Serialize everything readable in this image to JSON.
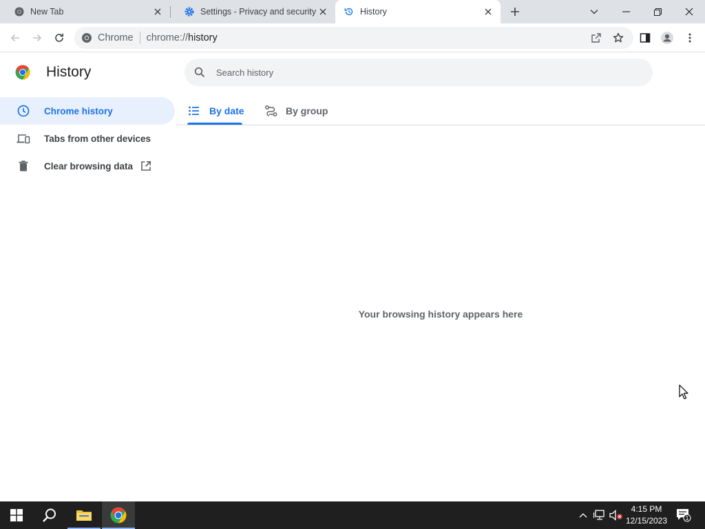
{
  "browser": {
    "tabs": [
      {
        "title": "New Tab",
        "icon": "chrome-icon"
      },
      {
        "title": "Settings - Privacy and security",
        "icon": "settings-gear-icon"
      },
      {
        "title": "History",
        "icon": "history-icon",
        "active": true
      }
    ],
    "omnibox": {
      "site_chip": "Chrome",
      "url_prefix": "chrome://",
      "url_path": "history"
    }
  },
  "page": {
    "title": "History",
    "search_placeholder": "Search history",
    "nav": [
      {
        "label": "Chrome history",
        "icon": "clock-icon",
        "active": true
      },
      {
        "label": "Tabs from other devices",
        "icon": "devices-icon"
      },
      {
        "label": "Clear browsing data",
        "icon": "trash-icon"
      }
    ],
    "view_tabs": [
      {
        "label": "By date",
        "icon": "list-icon",
        "active": true
      },
      {
        "label": "By group",
        "icon": "group-icon"
      }
    ],
    "empty_message": "Your browsing history appears here"
  },
  "taskbar": {
    "time": "4:15 PM",
    "date": "12/15/2023",
    "notification_count": "1"
  },
  "colors": {
    "accent": "#1a73e8",
    "active_nav_bg": "#e8f0fe",
    "tabstrip_bg": "#dee1e6",
    "taskbar_bg": "#1f1f1f"
  }
}
